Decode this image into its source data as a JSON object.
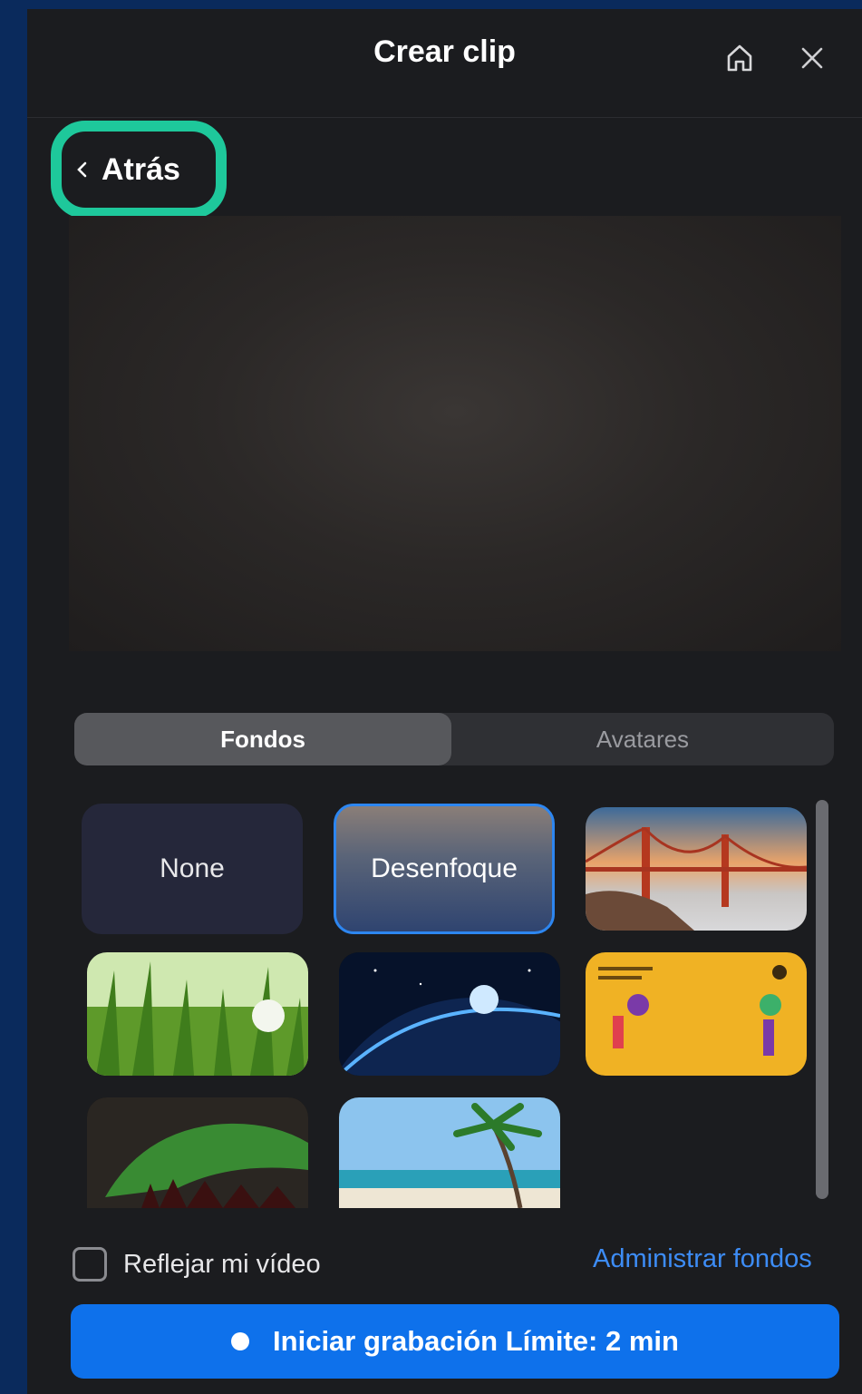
{
  "header": {
    "title": "Crear clip",
    "home_icon": "home-icon",
    "close_icon": "close-icon"
  },
  "back": {
    "label": "Atrás",
    "highlight_color": "#1ec89b"
  },
  "tabs": [
    {
      "label": "Fondos",
      "active": true
    },
    {
      "label": "Avatares",
      "active": false
    }
  ],
  "backgrounds": [
    {
      "label": "None",
      "kind": "text"
    },
    {
      "label": "Desenfoque",
      "kind": "text",
      "selected": true
    },
    {
      "name": "golden-gate-bridge",
      "kind": "image"
    },
    {
      "name": "grass",
      "kind": "image"
    },
    {
      "name": "earth-from-space",
      "kind": "image"
    },
    {
      "name": "yellow-illustration",
      "kind": "image"
    },
    {
      "name": "aurora",
      "kind": "image"
    },
    {
      "name": "beach-palm",
      "kind": "image"
    }
  ],
  "footer": {
    "mirror_label": "Reflejar mi vídeo",
    "mirror_checked": false,
    "manage_label": "Administrar fondos",
    "record_label": "Iniciar grabación Límite: 2 min"
  },
  "colors": {
    "accent": "#0e71eb",
    "link": "#3d8cf5",
    "panel": "#1b1c1f",
    "page_background": "#0a2a5c"
  }
}
